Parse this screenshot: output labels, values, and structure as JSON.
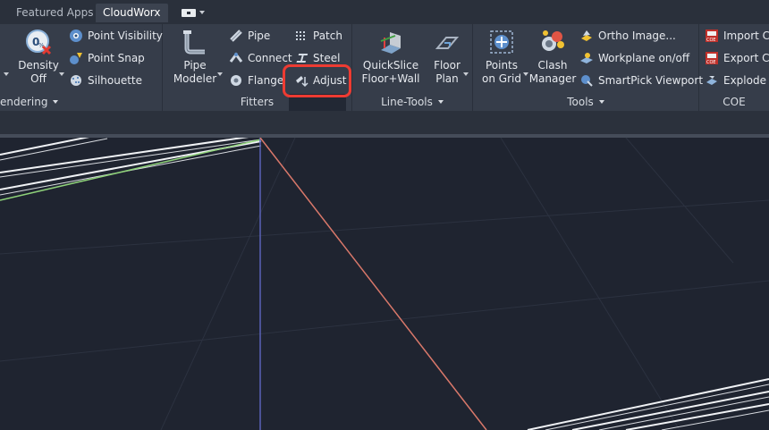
{
  "tabs": [
    {
      "label": "Featured Apps",
      "active": false
    },
    {
      "label": "CloudWorx",
      "active": true
    }
  ],
  "panels": {
    "rendering": {
      "title": "endering",
      "density": {
        "line1": "Density",
        "line2": "Off"
      },
      "point_visibility": "Point Visibility",
      "point_snap": "Point Snap",
      "silhouette": "Silhouette"
    },
    "fitters": {
      "title": "Fitters",
      "pipe_modeler": {
        "line1": "Pipe",
        "line2": "Modeler"
      },
      "pipe": "Pipe",
      "connect": "Connect",
      "flange": "Flange",
      "patch": "Patch",
      "steel": "Steel",
      "adjust": "Adjust"
    },
    "line_tools": {
      "title": "Line-Tools",
      "quickslice": {
        "line1": "QuickSlice",
        "line2": "Floor+Wall"
      },
      "floor_plan": {
        "line1": "Floor",
        "line2": "Plan"
      }
    },
    "tools": {
      "title": "Tools",
      "points_on_grid": {
        "line1": "Points",
        "line2": "on Grid"
      },
      "clash_manager": {
        "line1": "Clash",
        "line2": "Manager"
      },
      "ortho_image": "Ortho Image...",
      "workplane": "Workplane on/off",
      "smartpick": "SmartPick Viewport"
    },
    "coe": {
      "title": "COE",
      "import": "Import C",
      "export": "Export C",
      "explode": "Explode E"
    }
  },
  "colors": {
    "highlight": "#ee3b32",
    "axis_blue": "#5a62b8",
    "axis_red": "#d9786a",
    "green_line": "#8fd27a"
  }
}
